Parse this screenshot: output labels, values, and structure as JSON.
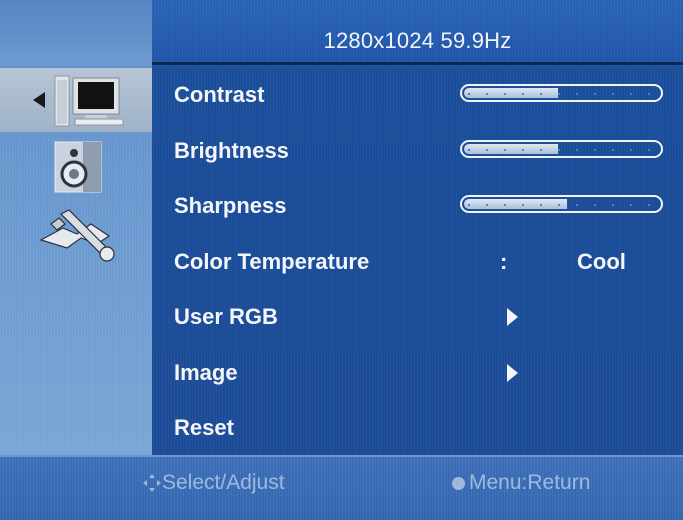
{
  "header": {
    "resolution": "1280x1024 59.9Hz"
  },
  "sidebar": {
    "items": [
      {
        "name": "monitor-icon",
        "active": true
      },
      {
        "name": "speaker-icon",
        "active": false
      },
      {
        "name": "tools-icon",
        "active": false
      }
    ]
  },
  "menu": {
    "contrast": {
      "label": "Contrast",
      "level": 0.47
    },
    "brightness": {
      "label": "Brightness",
      "level": 0.47
    },
    "sharpness": {
      "label": "Sharpness",
      "level": 0.52
    },
    "color_temperature": {
      "label": "Color Temperature",
      "separator": ":",
      "value": "Cool"
    },
    "user_rgb": {
      "label": "User RGB"
    },
    "image": {
      "label": "Image"
    },
    "reset": {
      "label": "Reset"
    }
  },
  "footer": {
    "select_hint": "Select/Adjust",
    "return_hint": "Menu:Return"
  },
  "colors": {
    "background": "#1c4f9c",
    "sidebar": "#6b9ad0",
    "text": "#f4f6fa",
    "footer_text": "#9fb9de"
  }
}
